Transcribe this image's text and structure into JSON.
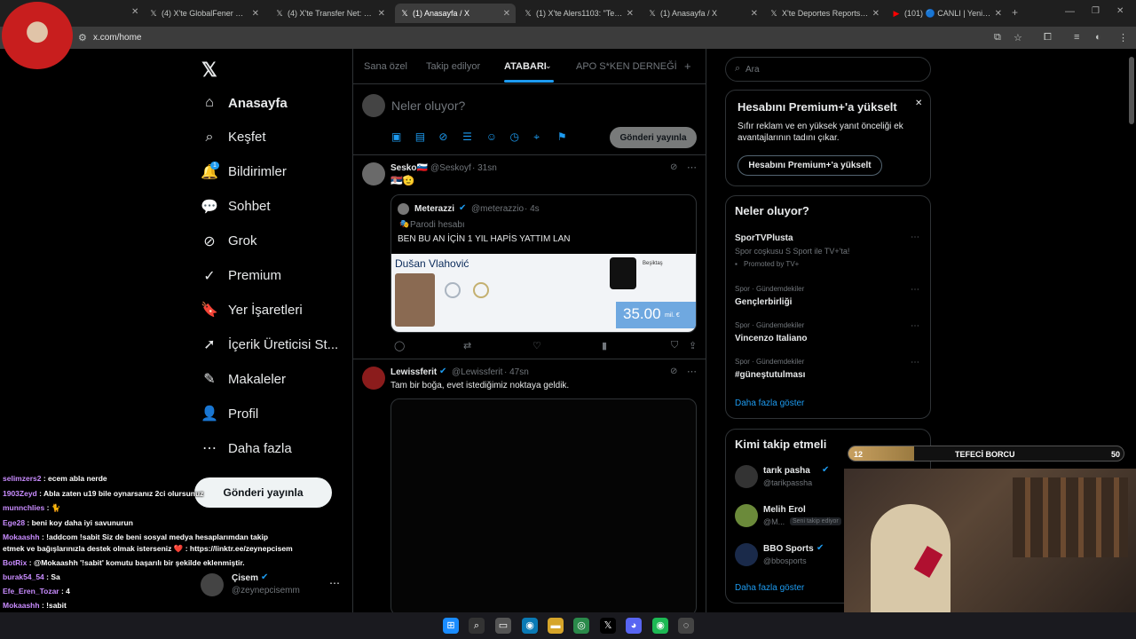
{
  "browser": {
    "tabs": [
      {
        "label": "(4) X'te GlobalFener 🔭: \"S",
        "favicon": "x-icon",
        "active": false
      },
      {
        "label": "(4) X'te Transfer Net: \"🔴 /",
        "favicon": "x-icon",
        "active": false
      },
      {
        "label": "(1) Anasayfa / X",
        "favicon": "x-icon",
        "active": true
      },
      {
        "label": "(1) X'te Alers1103: \"Tesisle",
        "favicon": "x-icon",
        "active": false
      },
      {
        "label": "(1) Anasayfa / X",
        "favicon": "x-icon",
        "active": false
      },
      {
        "label": "X'te Deportes Reports: \"Bo",
        "favicon": "x-icon",
        "active": false
      },
      {
        "label": "(101) 🔵 CANLI | Yeni Tra",
        "favicon": "youtube-icon",
        "active": false
      }
    ],
    "url": "x.com/home"
  },
  "nav": {
    "items": [
      {
        "label": "Anasayfa",
        "icon": "home-icon",
        "glyph": "⌂",
        "bold": true
      },
      {
        "label": "Keşfet",
        "icon": "search-icon",
        "glyph": "⌕"
      },
      {
        "label": "Bildirimler",
        "icon": "bell-icon",
        "glyph": "🔔",
        "badge": "1"
      },
      {
        "label": "Sohbet",
        "icon": "chat-icon",
        "glyph": "💬"
      },
      {
        "label": "Grok",
        "icon": "grok-icon",
        "glyph": "⊘"
      },
      {
        "label": "Premium",
        "icon": "premium-icon",
        "glyph": "✓"
      },
      {
        "label": "Yer İşaretleri",
        "icon": "bookmark-icon",
        "glyph": "🔖"
      },
      {
        "label": "İçerik Üreticisi St...",
        "icon": "rocket-icon",
        "glyph": "➚"
      },
      {
        "label": "Makaleler",
        "icon": "article-icon",
        "glyph": "✎"
      },
      {
        "label": "Profil",
        "icon": "profile-icon",
        "glyph": "👤"
      },
      {
        "label": "Daha fazla",
        "icon": "more-icon",
        "glyph": "⋯"
      }
    ],
    "post_button": "Gönderi yayınla",
    "account": {
      "name": "Çisem",
      "handle": "@zeynepcisemm"
    }
  },
  "main": {
    "tabs": [
      {
        "label": "Sana özel",
        "active": false
      },
      {
        "label": "Takip edilyor",
        "active": false
      },
      {
        "label": "ATABARI",
        "active": true
      },
      {
        "label": "APO S*KEN DERNEĞİ",
        "active": false
      }
    ],
    "add_tab": "+",
    "composer": {
      "placeholder": "Neler oluyor?",
      "post_button": "Gönderi yayınla"
    },
    "tweets": [
      {
        "name": "Sesko🇸🇮",
        "handle": "@Seskoyf",
        "time": "· 31sn",
        "text": "🇷🇸🫡",
        "quote": {
          "name": "Meterazzi",
          "handle": "@meterazzio",
          "time": "· 4s",
          "parody": "Parodi hesabı",
          "text": "BEN BU AN İÇİN 1 YIL HAPİS YATTIM LAN",
          "card_player": "Dušan Vlahović",
          "card_club": "Beşiktaş",
          "card_value": "35.00",
          "card_unit": "mil. €"
        }
      },
      {
        "name": "Lewissferit",
        "handle": "@Lewissferit",
        "time": "· 47sn",
        "text": "Tam bir boğa, evet istediğimiz noktaya geldik."
      }
    ]
  },
  "right": {
    "search_placeholder": "Ara",
    "premium": {
      "title": "Hesabını Premium+'a yükselt",
      "body": "Sıfır reklam ve en yüksek yanıt önceliği ek avantajlarının tadını çıkar.",
      "button": "Hesabını Premium+'a yükselt"
    },
    "trends": {
      "title": "Neler oluyor?",
      "promoted": {
        "name": "SporTVPlusta",
        "desc": "Spor coşkusu S Sport ile TV+'ta!",
        "tag": "Promoted by TV+"
      },
      "items": [
        {
          "category": "Spor · Gündemdekiler",
          "name": "Gençlerbirliği"
        },
        {
          "category": "Spor · Gündemdekiler",
          "name": "Vincenzo Italiano"
        },
        {
          "category": "Spor · Gündemdekiler",
          "name": "#güneştutulması"
        }
      ],
      "more": "Daha fazla göster"
    },
    "follow": {
      "title": "Kimi takip etmeli",
      "items": [
        {
          "name": "tarık pasha",
          "handle": "@tarikpassha",
          "verified": true
        },
        {
          "name": "Melih Erol",
          "handle": "@M...",
          "note": "Seni takip ediyor"
        },
        {
          "name": "BBO Sports",
          "handle": "@bbosports",
          "verified": true
        }
      ],
      "more": "Daha fazla göster"
    }
  },
  "chat": [
    {
      "user": "selimzers2",
      "msg": " : ecem abla nerde"
    },
    {
      "user": "1903Zeyd",
      "msg": " : Abla zaten u19 bile oynarsanız 2ci olursunuz"
    },
    {
      "user": "munnchlies",
      "msg": " : 🐈"
    },
    {
      "user": "Ege28",
      "msg": " : beni koy daha iyi savunurun"
    },
    {
      "user": "Mokaashh",
      "msg": " : !addcom !sabit Siz de beni sosyal medya hesaplarımdan takip"
    },
    {
      "user": "",
      "msg": "etmek ve bağışlarınızla destek olmak isterseniz ❤️ : https://linktr.ee/zeynepcisem"
    },
    {
      "user": "BotRix",
      "msg": " : @Mokaashh '!sabit' komutu başarılı bir şekilde eklenmiştir."
    },
    {
      "user": "burak54_54",
      "msg": " : Sa"
    },
    {
      "user": "Efe_Eren_Tozar",
      "msg": " : 4"
    },
    {
      "user": "Mokaashh",
      "msg": " : !sabit"
    },
    {
      "user": "BotRix",
      "msg": " : Siz de beni sosyal medya hesaplarımdan takip etmek ve bağışlarınızla"
    },
    {
      "user": "",
      "msg": "destek olmak isterseniz ❤️ : https://linktr.ee/zeynepcisem"
    }
  ],
  "overlay": {
    "bar_left": "12",
    "bar_title": "TEFECİ BORCU",
    "bar_right": "50",
    "progress": 0.24
  },
  "colors": {
    "accent": "#1d9bf0",
    "bg": "#000000",
    "border": "#2f3336",
    "muted": "#71767b"
  }
}
